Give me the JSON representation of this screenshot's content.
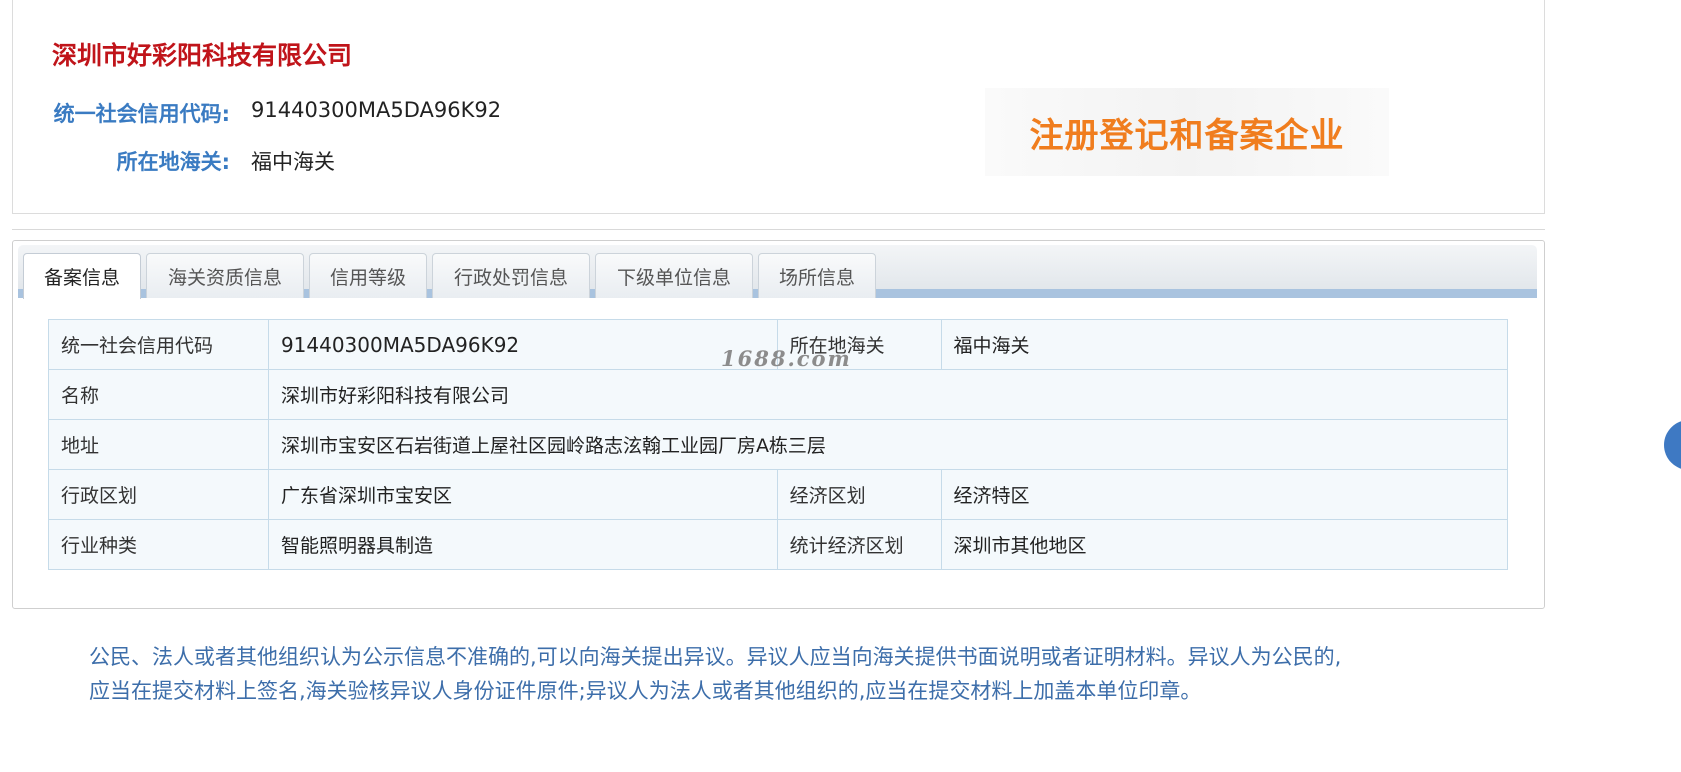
{
  "header": {
    "company_name": "深圳市好彩阳科技有限公司",
    "credit_code_label": "统一社会信用代码:",
    "credit_code_value": "91440300MA5DA96K92",
    "customs_label": "所在地海关:",
    "customs_value": "福中海关",
    "badge_text": "注册登记和备案企业"
  },
  "tabs": [
    {
      "label": "备案信息",
      "active": true
    },
    {
      "label": "海关资质信息",
      "active": false
    },
    {
      "label": "信用等级",
      "active": false
    },
    {
      "label": "行政处罚信息",
      "active": false
    },
    {
      "label": "下级单位信息",
      "active": false
    },
    {
      "label": "场所信息",
      "active": false
    }
  ],
  "table": {
    "credit_code_key": "统一社会信用代码",
    "credit_code_val": "91440300MA5DA96K92",
    "customs_key": "所在地海关",
    "customs_val": "福中海关",
    "name_key": "名称",
    "name_val": "深圳市好彩阳科技有限公司",
    "address_key": "地址",
    "address_val": "深圳市宝安区石岩街道上屋社区园岭路志泫翰工业园厂房A栋三层",
    "admin_region_key": "行政区划",
    "admin_region_val": "广东省深圳市宝安区",
    "econ_region_key": "经济区划",
    "econ_region_val": "经济特区",
    "industry_key": "行业种类",
    "industry_val": "智能照明器具制造",
    "stat_region_key": "统计经济区划",
    "stat_region_val": "深圳市其他地区"
  },
  "watermark": "1688.com",
  "notice": {
    "line1": "公民、法人或者其他组织认为公示信息不准确的,可以向海关提出异议。异议人应当向海关提供书面说明或者证明材料。异议人为公民的,",
    "line2": "应当在提交材料上签名,海关验核异议人身份证件原件;异议人为法人或者其他组织的,应当在提交材料上加盖本单位印章。"
  },
  "colors": {
    "company_name": "#c0141a",
    "label_blue": "#3a7bc2",
    "badge_orange": "#f07d1e",
    "notice_blue": "#3d6eaa",
    "table_border": "#c6dbe9",
    "table_bg": "#f4f9fc"
  }
}
